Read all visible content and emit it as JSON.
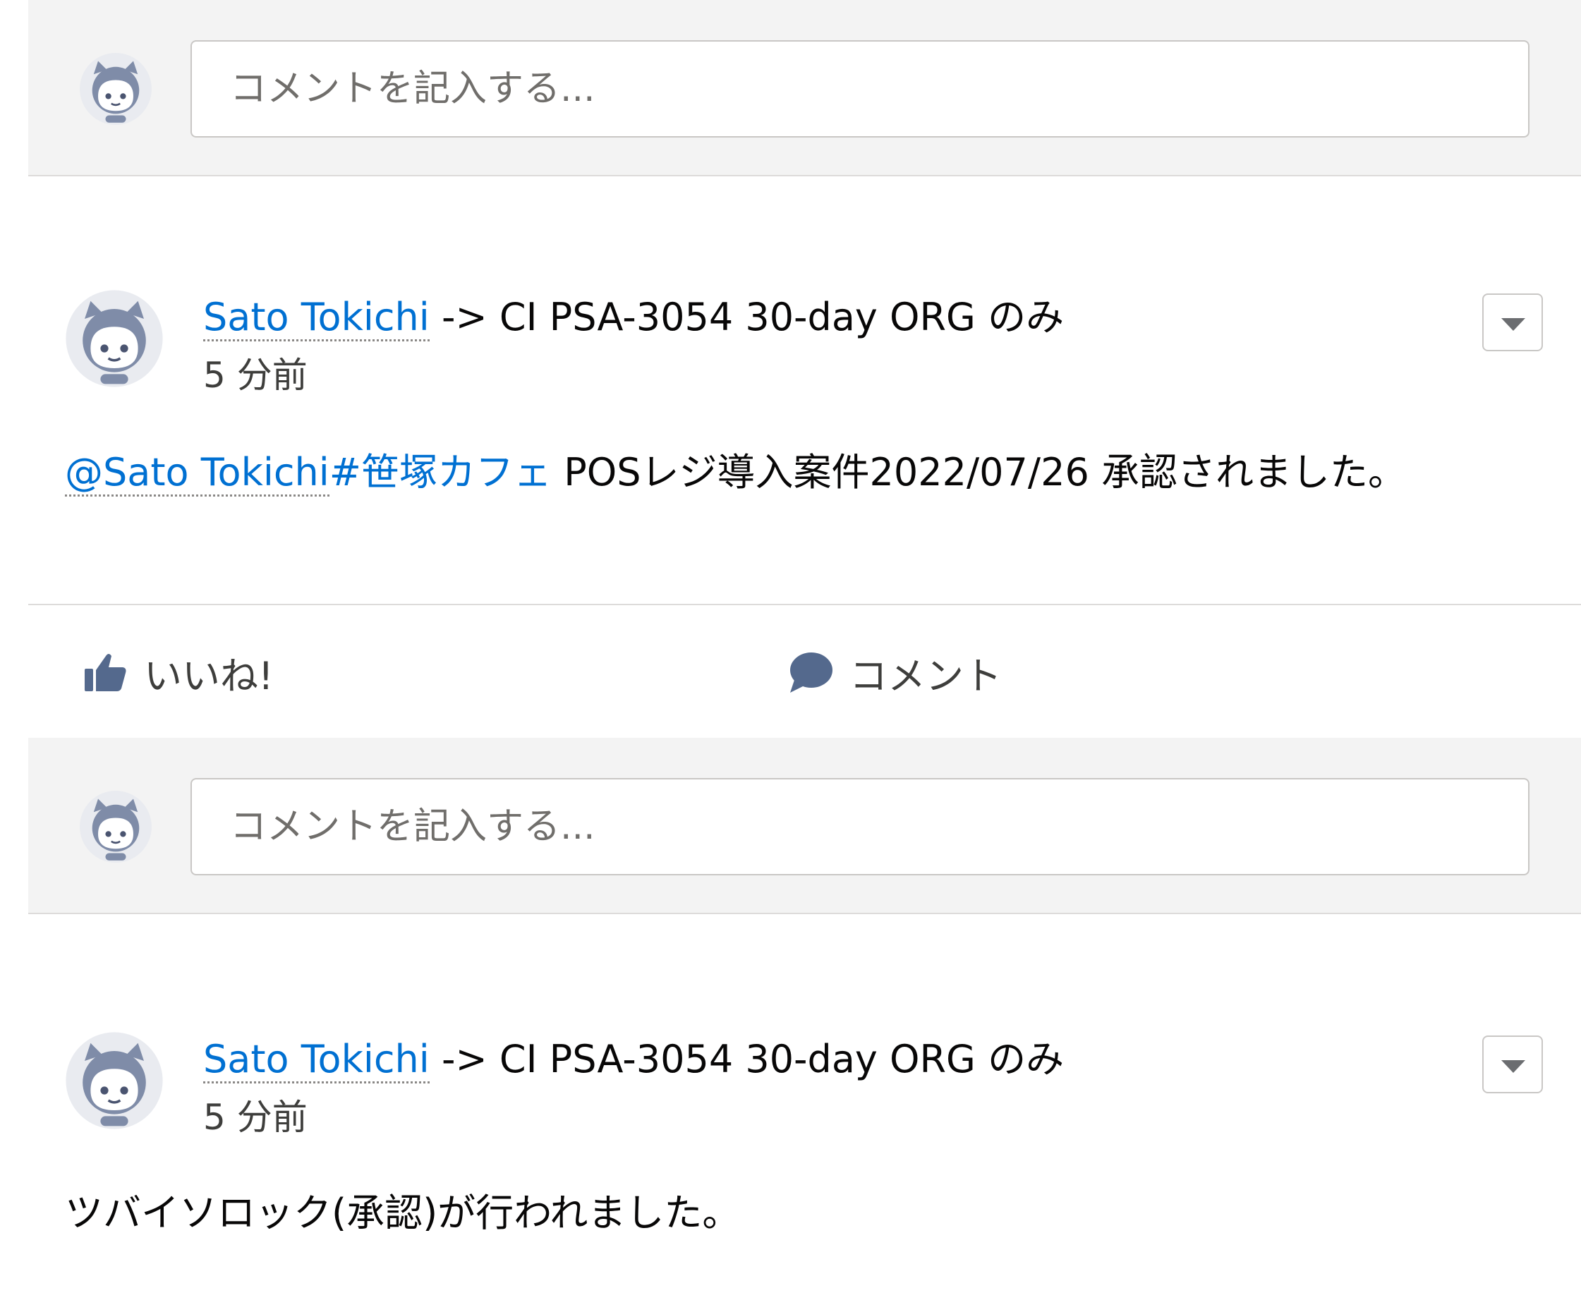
{
  "composer": {
    "placeholder": "コメントを記入する..."
  },
  "posts": [
    {
      "author": "Sato Tokichi",
      "arrow": "->",
      "target": "CI PSA-3054 30-day ORG のみ",
      "time": "5 分前",
      "mention": "@Sato Tokichi",
      "hashtag": "#笹塚カフェ",
      "text": " POSレジ導入案件2022/07/26 承認されました。"
    },
    {
      "author": "Sato Tokichi",
      "arrow": "->",
      "target": "CI PSA-3054 30-day ORG のみ",
      "time": "5 分前",
      "text": "ツバイソロック(承認)が行われました。"
    }
  ],
  "actions": {
    "like_label": "いいね!",
    "comment_label": "コメント"
  },
  "icons": {
    "avatar": "user-avatar-icon",
    "menu": "chevron-down-icon",
    "like": "thumbs-up-icon",
    "comment": "speech-bubble-icon"
  },
  "colors": {
    "link": "#0070d2",
    "composer_bg": "#f3f3f3",
    "avatar": "#7f8ca8"
  }
}
